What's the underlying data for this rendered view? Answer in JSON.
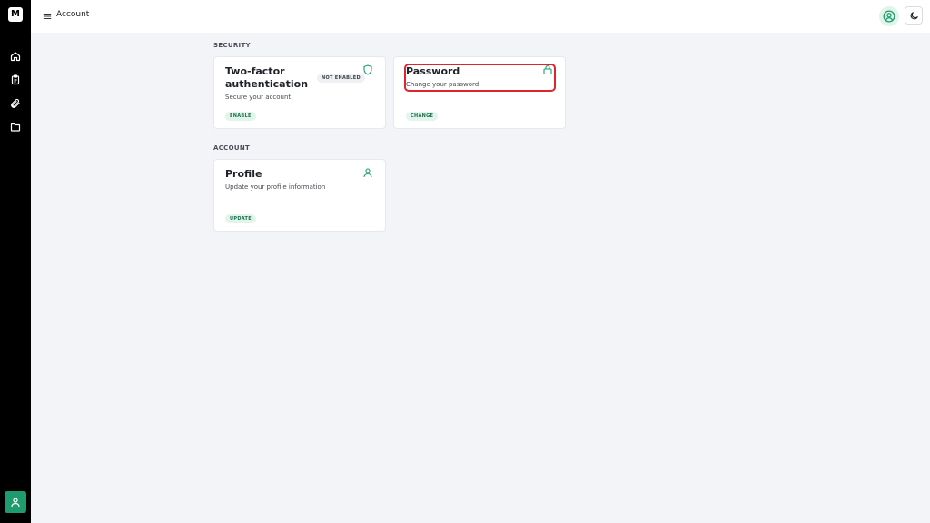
{
  "app": {
    "logo_text": "M"
  },
  "header": {
    "title": "Account"
  },
  "colors": {
    "accent": "#1f9c6e",
    "highlight": "#e0242c",
    "sidebar_bg": "#000000"
  },
  "sidebar": {
    "items": [
      {
        "icon": "home-icon"
      },
      {
        "icon": "clipboard-icon"
      },
      {
        "icon": "paperclip-icon"
      },
      {
        "icon": "folder-icon"
      }
    ],
    "footer_icon": "user-icon"
  },
  "sections": {
    "security": {
      "label": "SECURITY",
      "two_factor": {
        "title": "Two-factor authentication",
        "title_line1": "Two-factor",
        "title_line2": "authentication",
        "badge": "NOT ENABLED",
        "description": "Secure your account",
        "action": "ENABLE",
        "icon": "shield-icon"
      },
      "password": {
        "title": "Password",
        "description": "Change your password",
        "action": "CHANGE",
        "icon": "lock-icon"
      }
    },
    "account": {
      "label": "ACCOUNT",
      "profile": {
        "title": "Profile",
        "description": "Update your profile information",
        "action": "UPDATE",
        "icon": "user-icon"
      }
    }
  }
}
